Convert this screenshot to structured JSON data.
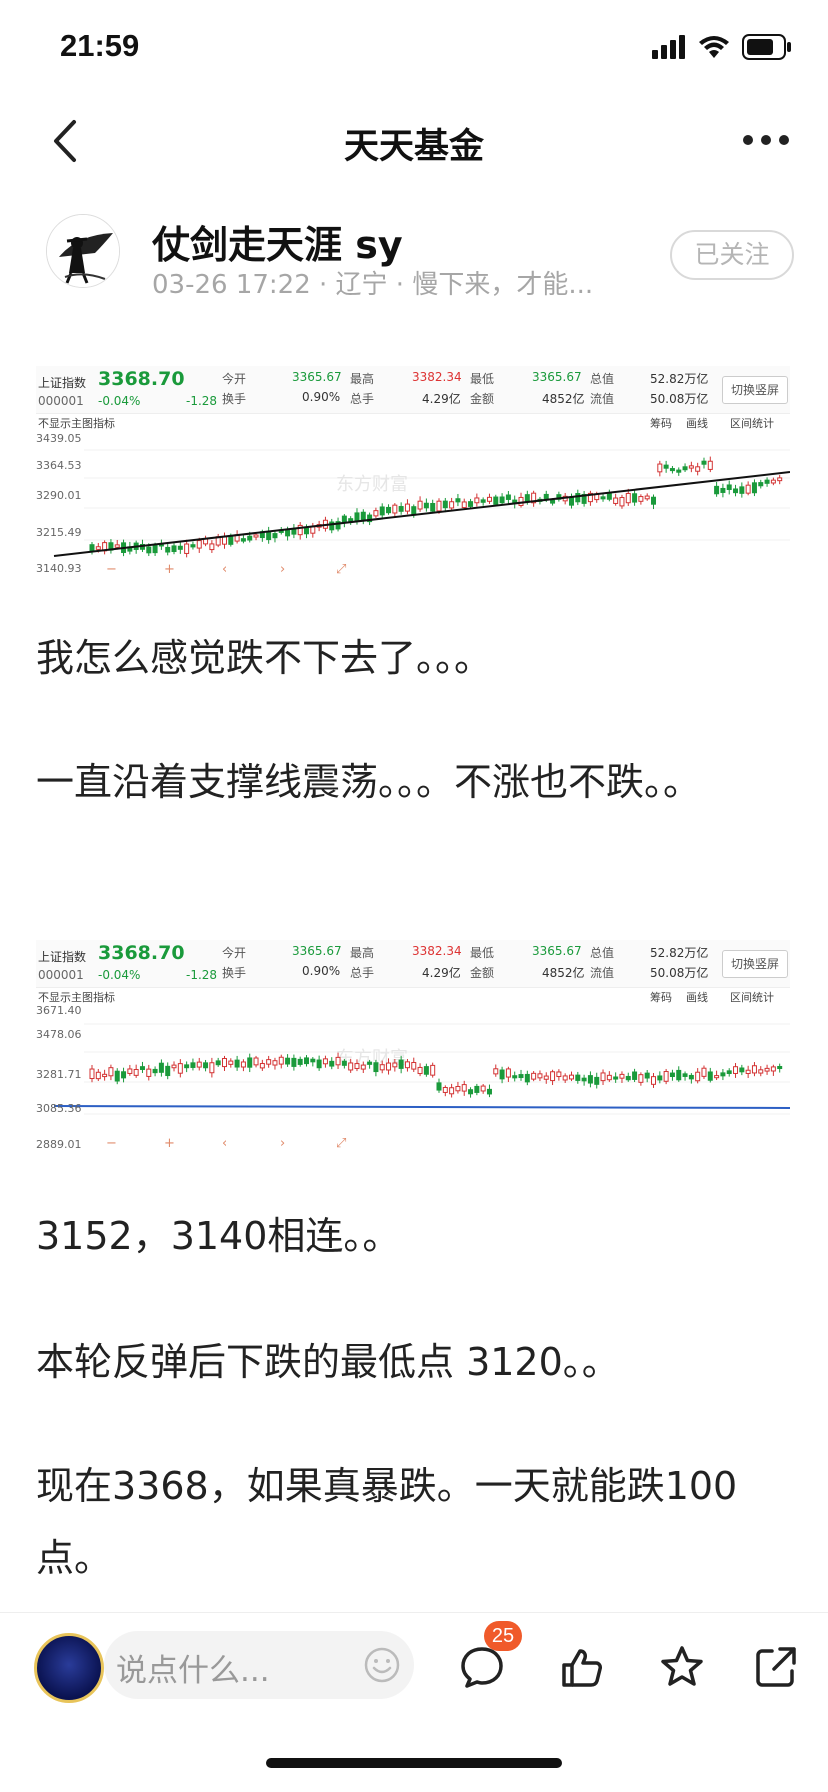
{
  "status_bar": {
    "time": "21:59"
  },
  "nav": {
    "title": "天天基金"
  },
  "author": {
    "name": "仗剑走天涯 sy",
    "meta": "03-26 17:22 · 辽宁 · 慢下来，才能...",
    "follow_label": "已关注"
  },
  "charts": [
    {
      "name": "上证指数",
      "price": "3368.70",
      "code": "000001",
      "pct": "-0.04%",
      "change": "-1.28",
      "open_label": "今开",
      "open": "3365.67",
      "high_label": "最高",
      "high": "3382.34",
      "low_label": "最低",
      "low": "3365.67",
      "total_label": "总值",
      "total": "52.82万亿",
      "turnover_label": "换手",
      "turnover": "0.90%",
      "volume_label": "总手",
      "volume": "4.29亿",
      "amount_label": "金额",
      "amount": "4852亿",
      "float_label": "流值",
      "float": "50.08万亿",
      "switch_label": "切换竖屏",
      "indicator_label": "不显示主图指标",
      "tools": [
        "筹码",
        "画线",
        "区间统计"
      ],
      "y_ticks": [
        "3439.05",
        "3364.53",
        "3290.01",
        "3215.49",
        "3140.93"
      ],
      "watermark": "东方财富"
    },
    {
      "name": "上证指数",
      "price": "3368.70",
      "code": "000001",
      "pct": "-0.04%",
      "change": "-1.28",
      "open_label": "今开",
      "open": "3365.67",
      "high_label": "最高",
      "high": "3382.34",
      "low_label": "最低",
      "low": "3365.67",
      "total_label": "总值",
      "total": "52.82万亿",
      "turnover_label": "换手",
      "turnover": "0.90%",
      "volume_label": "总手",
      "volume": "4.29亿",
      "amount_label": "金额",
      "amount": "4852亿",
      "float_label": "流值",
      "float": "50.08万亿",
      "switch_label": "切换竖屏",
      "indicator_label": "不显示主图指标",
      "tools": [
        "筹码",
        "画线",
        "区间统计"
      ],
      "y_ticks": [
        "3671.40",
        "3478.06",
        "3281.71",
        "3085.36",
        "2889.01"
      ],
      "watermark": "东方财富"
    }
  ],
  "post": {
    "p1": "我怎么感觉跌不下去了。。。",
    "p2": "一直沿着支撑线震荡。。。不涨也不跌。。",
    "p3": "3152，3140相连。。",
    "p4": "本轮反弹后下跌的最低点 3120。。",
    "p5": "现在3368，如果真暴跌。一天就能跌100点。"
  },
  "bottom": {
    "comment_placeholder": "说点什么...",
    "comment_count": "25"
  },
  "colors": {
    "up": "#d33333",
    "down": "#1a9a3b",
    "badge": "#f05a2a"
  },
  "icons": [
    "back-icon",
    "more-icon",
    "signal-icon",
    "wifi-icon",
    "battery-icon",
    "emoji-icon",
    "comment-icon",
    "like-icon",
    "star-icon",
    "share-icon"
  ]
}
